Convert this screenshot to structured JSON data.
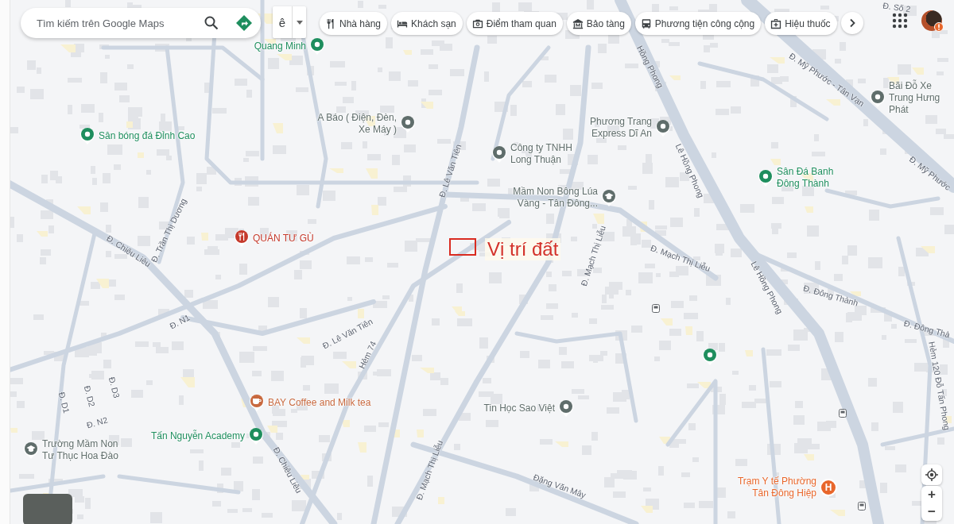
{
  "search": {
    "placeholder": "Tìm kiếm trên Google Maps"
  },
  "input_tool": {
    "label": "ê"
  },
  "categories": [
    {
      "label": "Nhà hàng",
      "kind": "restaurant"
    },
    {
      "label": "Khách sạn",
      "kind": "hotel"
    },
    {
      "label": "Điểm tham quan",
      "kind": "camera"
    },
    {
      "label": "Bảo tàng",
      "kind": "museum"
    },
    {
      "label": "Phương tiện công cộng",
      "kind": "transit"
    },
    {
      "label": "Hiệu thuốc",
      "kind": "pharmacy"
    }
  ],
  "places": [
    {
      "name": "Quang Minh",
      "kind": "pin",
      "color": "#1e8e5e"
    },
    {
      "name": "Sân bóng đá Đỉnh Cao",
      "kind": "pin",
      "color": "#1e8e5e"
    },
    {
      "name": "A Báo ( Điện, Đèn, Xe Máy )",
      "kind": "pin",
      "color": "#5f6d6b"
    },
    {
      "name": "Công ty TNHH Long Thuận",
      "kind": "pin",
      "color": "#5f6d6b"
    },
    {
      "name": "Phương Trang Express Dĩ An",
      "kind": "pin",
      "color": "#5f6d6b"
    },
    {
      "name": "Mầm Non Bông Lúa Vàng - Tân Đông...",
      "kind": "school",
      "color": "#5f6d6b"
    },
    {
      "name": "QUÁN TƯ GÙ",
      "kind": "restaurant",
      "color": "#c5392b"
    },
    {
      "name": "Sân Đá Banh Đông Thành",
      "kind": "pin",
      "color": "#1e8e5e"
    },
    {
      "name": "Bãi Đỗ Xe Trung Hưng Phát",
      "kind": "pin",
      "color": "#5f6d6b"
    },
    {
      "name": "BAY Coffee and Milk tea",
      "kind": "cafe",
      "color": "#c8693f"
    },
    {
      "name": "Tấn Nguyễn Academy",
      "kind": "pin",
      "color": "#1e8e5e"
    },
    {
      "name": "Trường Mầm Non Tư Thục Hoa Đào",
      "kind": "school",
      "color": "#5f6d6b"
    },
    {
      "name": "Tin Học Sao Việt",
      "kind": "pin",
      "color": "#5f6d6b"
    },
    {
      "kind": "pin",
      "color": "#1e8e5e"
    },
    {
      "name": "Trạm Y tế Phường Tân Đông Hiệp",
      "kind": "hospital",
      "color": "#e8662b",
      "icon_label": "H"
    }
  ],
  "roads": [
    "Đ. Số 2",
    "Đ. Mỹ Phước - Tân Vạn",
    "Đ. Mỹ Phước",
    "Hồng Phong",
    "Lê Hồng Phong",
    "Lê Hồng Phong",
    "Đ. Lê Văn Tiên",
    "Đ. Trần Thị Dương",
    "Đ. Chiêu Liêu",
    "Đ. Mạch Thị Liễu",
    "Đ. Mạch Thị Liễu",
    "Đ. Đông Thành",
    "Đ. Đông Thà",
    "Hẻm 120 Đỗ Tấn Phong",
    "Đ. N1",
    "Đ. Lê Văn Tiên",
    "Hẻm 74",
    "Đ. D1",
    "Đ. D2",
    "Đ. D3",
    "Đ. N2",
    "Đ. Chiêu Liêu",
    "Đ. Mạch Thị Liễu",
    "Đặng Văn Mây"
  ],
  "annotation": {
    "label": "Vị trí đất"
  },
  "zoom": {
    "in": "+",
    "out": "−"
  }
}
